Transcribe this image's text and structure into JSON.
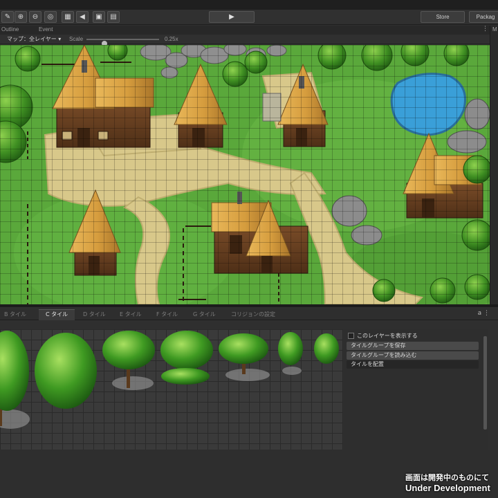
{
  "toolbar": {
    "icons": [
      "zoom-in-icon",
      "zoom-out-icon",
      "zoom-reset-icon",
      "layout-icon",
      "sound-icon",
      "storage-icon",
      "folder-icon"
    ],
    "play_icon": "play-icon",
    "store_label": "Store",
    "packages_label": "Packag"
  },
  "panel_tabs": {
    "outline": "Outline",
    "event": "Event",
    "side": "M",
    "menu": "⋮"
  },
  "map_options": {
    "layer_select": "マップ：全レイヤー ▾",
    "scale_label": "Scale",
    "scale_value": "0.25x",
    "scale_fraction": 0.25
  },
  "tile_tabs": {
    "items": [
      {
        "label": "B タイル",
        "active": false
      },
      {
        "label": "C タイル",
        "active": true
      },
      {
        "label": "D タイル",
        "active": false
      },
      {
        "label": "E タイル",
        "active": false
      },
      {
        "label": "F タイル",
        "active": false
      },
      {
        "label": "G タイル",
        "active": false
      },
      {
        "label": "コリジョンの設定",
        "active": false
      }
    ],
    "icons": "a ⋮"
  },
  "tile_panel": {
    "show_layer": "このレイヤーを表示する",
    "save_group": "タイルグループを保存",
    "load_group": "タイルグループを読み込む",
    "place_tile": "タイルを配置"
  },
  "watermark": {
    "line1": "画面は開発中のものにて",
    "line2": "Under Development"
  },
  "colors": {
    "grass": "#58a63a",
    "path": "#d8c88a",
    "roof": "#d9a446",
    "wall": "#6e4526",
    "water": "#3a9fd8",
    "rock": "#8c8c8c",
    "panel_bg": "#2f2f2f"
  }
}
